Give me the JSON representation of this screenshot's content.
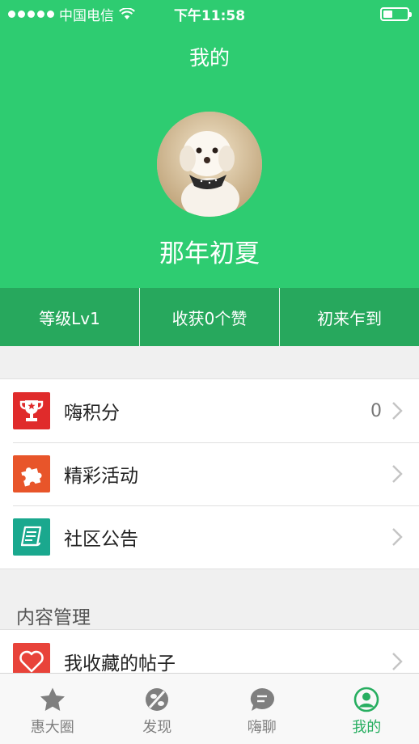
{
  "status_bar": {
    "carrier": "中国电信",
    "time": "下午11:58",
    "battery_level": 0.35
  },
  "header": {
    "title": "我的",
    "username": "那年初夏"
  },
  "stats": [
    {
      "label": "等级Lv1"
    },
    {
      "label": "收获0个赞"
    },
    {
      "label": "初来乍到"
    }
  ],
  "menu": {
    "points": {
      "label": "嗨积分",
      "value": "0",
      "icon": "trophy-icon",
      "color": "#e02b2b"
    },
    "events": {
      "label": "精彩活动",
      "icon": "puzzle-icon",
      "color": "#e8552a"
    },
    "notice": {
      "label": "社区公告",
      "icon": "notice-icon",
      "color": "#1aa88e"
    }
  },
  "content_section": {
    "title": "内容管理",
    "favorites": {
      "label": "我收藏的帖子",
      "icon": "heart-icon",
      "color": "#e8433a"
    }
  },
  "tabs": [
    {
      "label": "惠大圈",
      "icon": "star-icon"
    },
    {
      "label": "发现",
      "icon": "discover-icon"
    },
    {
      "label": "嗨聊",
      "icon": "chat-icon"
    },
    {
      "label": "我的",
      "icon": "profile-icon",
      "active": true
    }
  ],
  "colors": {
    "brand_green": "#2ecc71",
    "stats_green": "#27a85d",
    "active_tab": "#27ae60"
  }
}
